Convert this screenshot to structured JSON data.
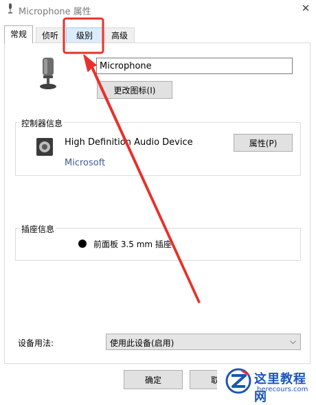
{
  "window": {
    "title": "Microphone 属性",
    "close_icon": "close-icon"
  },
  "tabs": [
    {
      "label": "常规",
      "active": true
    },
    {
      "label": "侦听",
      "active": false
    },
    {
      "label": "级别",
      "active": false,
      "highlighted": true
    },
    {
      "label": "高级",
      "active": false
    }
  ],
  "general": {
    "device_name_value": "Microphone",
    "change_icon_button": "更改图标(I)",
    "controller": {
      "section_label": "控制器信息",
      "device_name": "High Definition Audio Device",
      "vendor": "Microsoft",
      "properties_button": "属性(P)"
    },
    "jack": {
      "section_label": "插座信息",
      "description": "前面板 3.5 mm 插座"
    },
    "usage": {
      "label": "设备用法:",
      "selected": "使用此设备(启用)"
    }
  },
  "footer": {
    "ok_button": "确定",
    "cancel_button_partial": "取"
  },
  "watermark": {
    "title": "这里教程网",
    "url": "herecours.com"
  },
  "colors": {
    "annotation_red": "#e8312a",
    "vendor_link": "#3c5a9a",
    "watermark_blue": "#1a56b8"
  }
}
